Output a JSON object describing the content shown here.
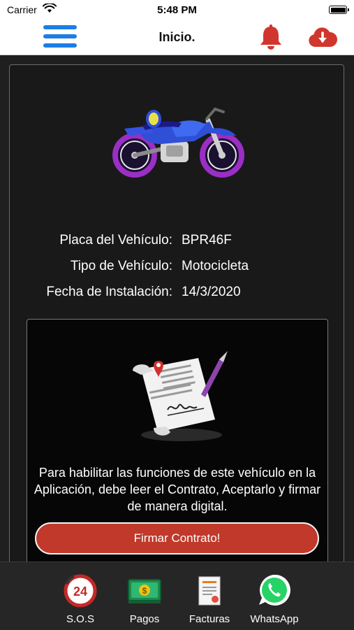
{
  "status_bar": {
    "carrier": "Carrier",
    "time": "5:48 PM"
  },
  "nav": {
    "title": "Inicio.",
    "menu_icon": "hamburger-icon",
    "notifications_icon": "bell-icon",
    "download_icon": "cloud-download-icon"
  },
  "vehicle": {
    "image": "motorcycle-image",
    "rows": [
      {
        "label": "Placa del Vehículo:",
        "value": "BPR46F"
      },
      {
        "label": "Tipo de Vehículo:",
        "value": "Motocicleta"
      },
      {
        "label": "Fecha de Instalación:",
        "value": "14/3/2020"
      }
    ]
  },
  "contract": {
    "image": "contract-document-image",
    "message": "Para habilitar las funciones de este vehículo en la Aplicación, debe leer el Contrato, Aceptarlo y firmar de manera digital.",
    "button_label": "Firmar Contrato!"
  },
  "tabs": [
    {
      "label": "S.O.S",
      "icon": "sos-24-icon"
    },
    {
      "label": "Pagos",
      "icon": "money-icon"
    },
    {
      "label": "Facturas",
      "icon": "invoice-icon"
    },
    {
      "label": "WhatsApp",
      "icon": "whatsapp-icon"
    }
  ],
  "colors": {
    "accent_blue": "#1b7ee6",
    "accent_red": "#c0392b",
    "background": "#1e1e1e"
  }
}
